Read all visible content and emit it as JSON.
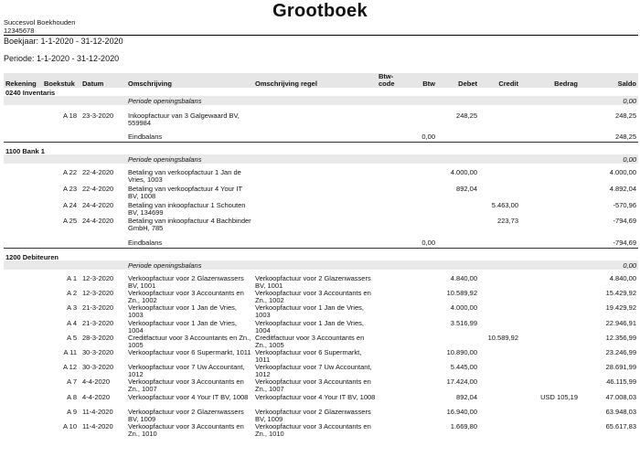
{
  "title": "Grootboek",
  "company": {
    "name": "Succesvol Boekhouden",
    "number": "12345678"
  },
  "boekjaar": "Boekjaar: 1-1-2020 - 31-12-2020",
  "periode": "Periode: 1-1-2020 - 31-12-2020",
  "headers": {
    "rekening": "Rekening",
    "boekstuk": "Boekstuk",
    "datum": "Datum",
    "omschrijving": "Omschrijving",
    "omschrijving_regel": "Omschrijving regel",
    "btw_code": "Btw-code",
    "btw": "Btw",
    "debet": "Debet",
    "credit": "Credit",
    "bedrag": "Bedrag",
    "saldo": "Saldo"
  },
  "sections": [
    {
      "account": "0240 Inventaris",
      "opening_label": "Periode openingsbalans",
      "opening_saldo": "0,00",
      "rows": [
        {
          "boekstuk": "A 18",
          "datum": "23-3-2020",
          "omschrijving": "Inkoopfactuur van 3 Galgewaard BV, 559984",
          "regel": "",
          "debet": "248,25",
          "credit": "",
          "bedrag": "",
          "saldo": "248,25"
        }
      ],
      "end_label": "Eindbalans",
      "end_btw": "0,00",
      "end_saldo": "248,25"
    },
    {
      "account": "1100 Bank 1",
      "opening_label": "Periode openingsbalans",
      "opening_saldo": "0,00",
      "rows": [
        {
          "boekstuk": "A 22",
          "datum": "22-4-2020",
          "omschrijving": "Betaling van verkoopfactuur 1 Jan de Vries, 1003",
          "regel": "",
          "debet": "4.000,00",
          "credit": "",
          "bedrag": "",
          "saldo": "4.000,00"
        },
        {
          "boekstuk": "A 23",
          "datum": "22-4-2020",
          "omschrijving": "Betaling van verkoopfactuur 4 Your IT BV, 1008",
          "regel": "",
          "debet": "892,04",
          "credit": "",
          "bedrag": "",
          "saldo": "4.892,04"
        },
        {
          "boekstuk": "A 24",
          "datum": "24-4-2020",
          "omschrijving": "Betaling van inkoopfactuur 1 Schouten BV, 134699",
          "regel": "",
          "debet": "",
          "credit": "5.463,00",
          "bedrag": "",
          "saldo": "-570,96"
        },
        {
          "boekstuk": "A 25",
          "datum": "24-4-2020",
          "omschrijving": "Betaling van inkoopfactuur 4 Bachbinder GmbH, 785",
          "regel": "",
          "debet": "",
          "credit": "223,73",
          "bedrag": "",
          "saldo": "-794,69"
        }
      ],
      "end_label": "Eindbalans",
      "end_btw": "0,00",
      "end_saldo": "-794,69"
    },
    {
      "account": "1200 Debiteuren",
      "opening_label": "Periode openingsbalans",
      "opening_saldo": "0,00",
      "rows": [
        {
          "boekstuk": "A 1",
          "datum": "12-3-2020",
          "omschrijving": "Verkoopfactuur voor 2 Glazenwassers BV, 1001",
          "regel": "Verkoopfactuur voor 2 Glazenwassers BV, 1001",
          "debet": "4.840,00",
          "credit": "",
          "bedrag": "",
          "saldo": "4.840,00"
        },
        {
          "boekstuk": "A 2",
          "datum": "12-3-2020",
          "omschrijving": "Verkoopfactuur voor 3 Accountants en Zn., 1002",
          "regel": "Verkoopfactuur voor 3 Accountants en Zn., 1002",
          "debet": "10.589,92",
          "credit": "",
          "bedrag": "",
          "saldo": "15.429,92"
        },
        {
          "boekstuk": "A 3",
          "datum": "21-3-2020",
          "omschrijving": "Verkoopfactuur voor 1 Jan de Vries, 1003",
          "regel": "Verkoopfactuur voor 1 Jan de Vries, 1003",
          "debet": "4.000,00",
          "credit": "",
          "bedrag": "",
          "saldo": "19.429,92"
        },
        {
          "boekstuk": "A 4",
          "datum": "21-3-2020",
          "omschrijving": "Verkoopfactuur voor 1 Jan de Vries, 1004",
          "regel": "Verkoopfactuur voor 1 Jan de Vries, 1004",
          "debet": "3.516,99",
          "credit": "",
          "bedrag": "",
          "saldo": "22.946,91"
        },
        {
          "boekstuk": "A 5",
          "datum": "28-3-2020",
          "omschrijving": "Creditfactuur voor 3 Accountants en Zn., 1005",
          "regel": "Creditfactuur voor 3 Accountants en Zn., 1005",
          "debet": "",
          "credit": "10.589,92",
          "bedrag": "",
          "saldo": "12.356,99"
        },
        {
          "boekstuk": "A 11",
          "datum": "30-3-2020",
          "omschrijving": "Verkoopfactuur voor 6 Supermarkt, 1011",
          "regel": "Verkoopfactuur voor 6 Supermarkt, 1011",
          "debet": "10.890,00",
          "credit": "",
          "bedrag": "",
          "saldo": "23.246,99"
        },
        {
          "boekstuk": "A 12",
          "datum": "30-3-2020",
          "omschrijving": "Verkoopfactuur voor 7 Uw Accountant, 1012",
          "regel": "Verkoopfactuur voor 7 Uw Accountant, 1012",
          "debet": "5.445,00",
          "credit": "",
          "bedrag": "",
          "saldo": "28.691,99"
        },
        {
          "boekstuk": "A 7",
          "datum": "4-4-2020",
          "omschrijving": "Verkoopfactuur voor 3 Accountants en Zn., 1007",
          "regel": "Verkoopfactuur voor 3 Accountants en Zn., 1007",
          "debet": "17.424,00",
          "credit": "",
          "bedrag": "",
          "saldo": "46.115,99"
        },
        {
          "boekstuk": "A 8",
          "datum": "4-4-2020",
          "omschrijving": "Verkoopfactuur voor 4 Your IT BV, 1008",
          "regel": "Verkoopfactuur voor 4 Your IT BV, 1008",
          "debet": "892,04",
          "credit": "",
          "bedrag": "USD 105,19",
          "saldo": "47.008,03"
        },
        {
          "boekstuk": "A 9",
          "datum": "11-4-2020",
          "omschrijving": "Verkoopfactuur voor 2 Glazenwassers BV, 1009",
          "regel": "Verkoopfactuur voor 2 Glazenwassers BV, 1009",
          "debet": "16.940,00",
          "credit": "",
          "bedrag": "",
          "saldo": "63.948,03"
        },
        {
          "boekstuk": "A 10",
          "datum": "11-4-2020",
          "omschrijving": "Verkoopfactuur voor 3 Accountants en Zn., 1010",
          "regel": "Verkoopfactuur voor 3 Accountants en Zn., 1010",
          "debet": "1.669,80",
          "credit": "",
          "bedrag": "",
          "saldo": "65.617,83"
        }
      ]
    }
  ]
}
